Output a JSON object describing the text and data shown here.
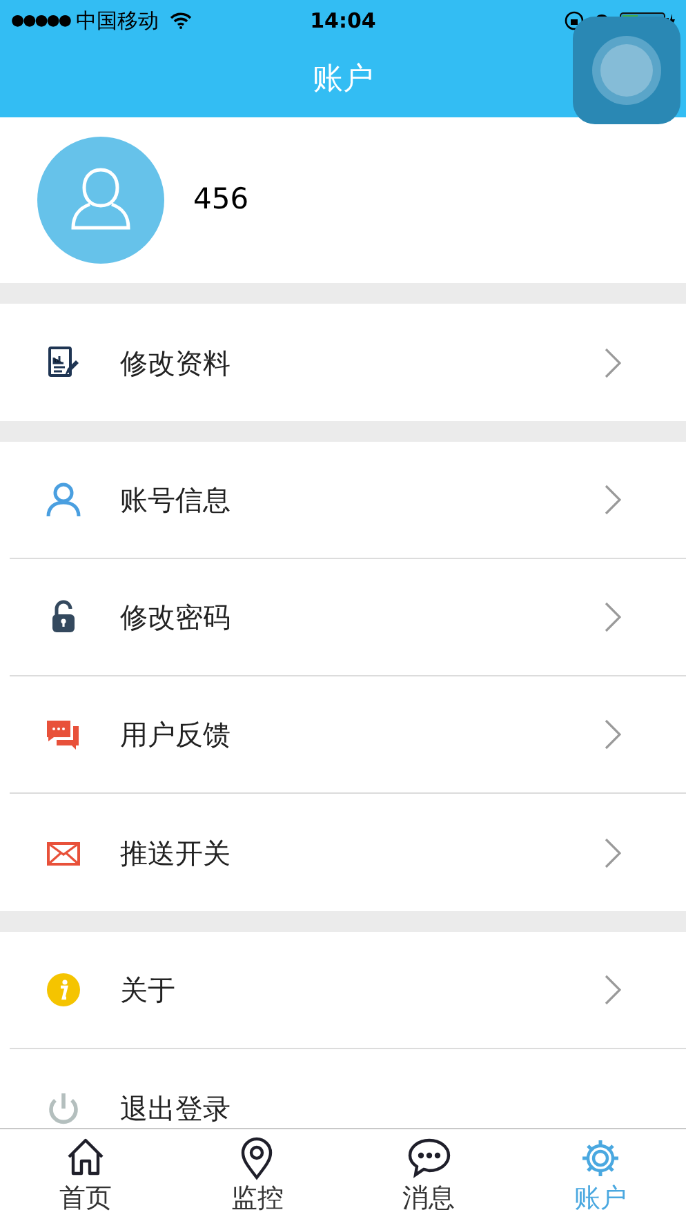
{
  "status_bar": {
    "signal_dots": "●●●●●",
    "carrier": "中国移动",
    "time": "14:04"
  },
  "nav_bar": {
    "title": "账户"
  },
  "profile": {
    "username": "456"
  },
  "menu_sections": [
    [
      {
        "label": "修改资料"
      }
    ],
    [
      {
        "label": "账号信息"
      },
      {
        "label": "修改密码"
      },
      {
        "label": "用户反馈"
      },
      {
        "label": "推送开关"
      }
    ],
    [
      {
        "label": "关于"
      },
      {
        "label": "退出登录"
      }
    ]
  ],
  "tab_bar": [
    {
      "label": "首页",
      "selected": false
    },
    {
      "label": "监控",
      "selected": false
    },
    {
      "label": "消息",
      "selected": false
    },
    {
      "label": "账户",
      "selected": true
    }
  ]
}
